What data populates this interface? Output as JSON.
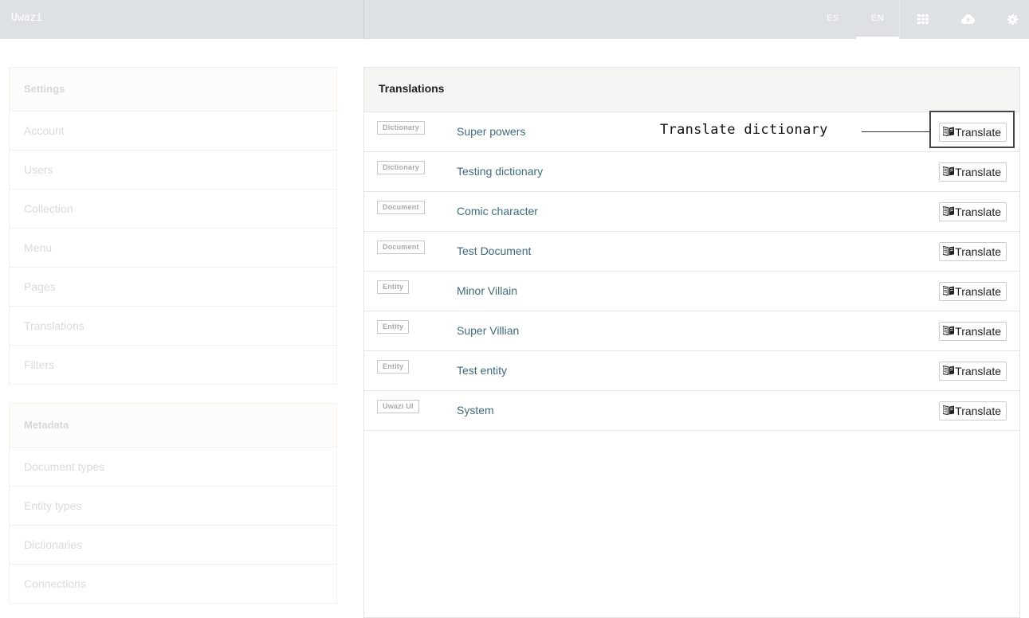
{
  "app": {
    "brand": "Uwazi"
  },
  "topbar": {
    "languages": [
      {
        "code": "ES",
        "active": false
      },
      {
        "code": "EN",
        "active": true
      }
    ],
    "icons": [
      "grid-icon",
      "cloud-upload-icon",
      "gear-icon"
    ]
  },
  "sidebar": {
    "settings": {
      "title": "Settings",
      "items": [
        "Account",
        "Users",
        "Collection",
        "Menu",
        "Pages",
        "Translations",
        "Filters"
      ]
    },
    "metadata": {
      "title": "Metadata",
      "items": [
        "Document types",
        "Entity types",
        "Dictionaries",
        "Connections"
      ]
    }
  },
  "main": {
    "title": "Translations",
    "button_label": "Translate",
    "rows": [
      {
        "type": "Dictionary",
        "name": "Super powers"
      },
      {
        "type": "Dictionary",
        "name": "Testing dictionary"
      },
      {
        "type": "Document",
        "name": "Comic character"
      },
      {
        "type": "Document",
        "name": "Test Document"
      },
      {
        "type": "Entity",
        "name": "Minor Villain"
      },
      {
        "type": "Entity",
        "name": "Super Villian"
      },
      {
        "type": "Entity",
        "name": "Test entity"
      },
      {
        "type": "Uwazi UI",
        "name": "System"
      }
    ]
  },
  "annotation": {
    "label": "Translate dictionary"
  }
}
